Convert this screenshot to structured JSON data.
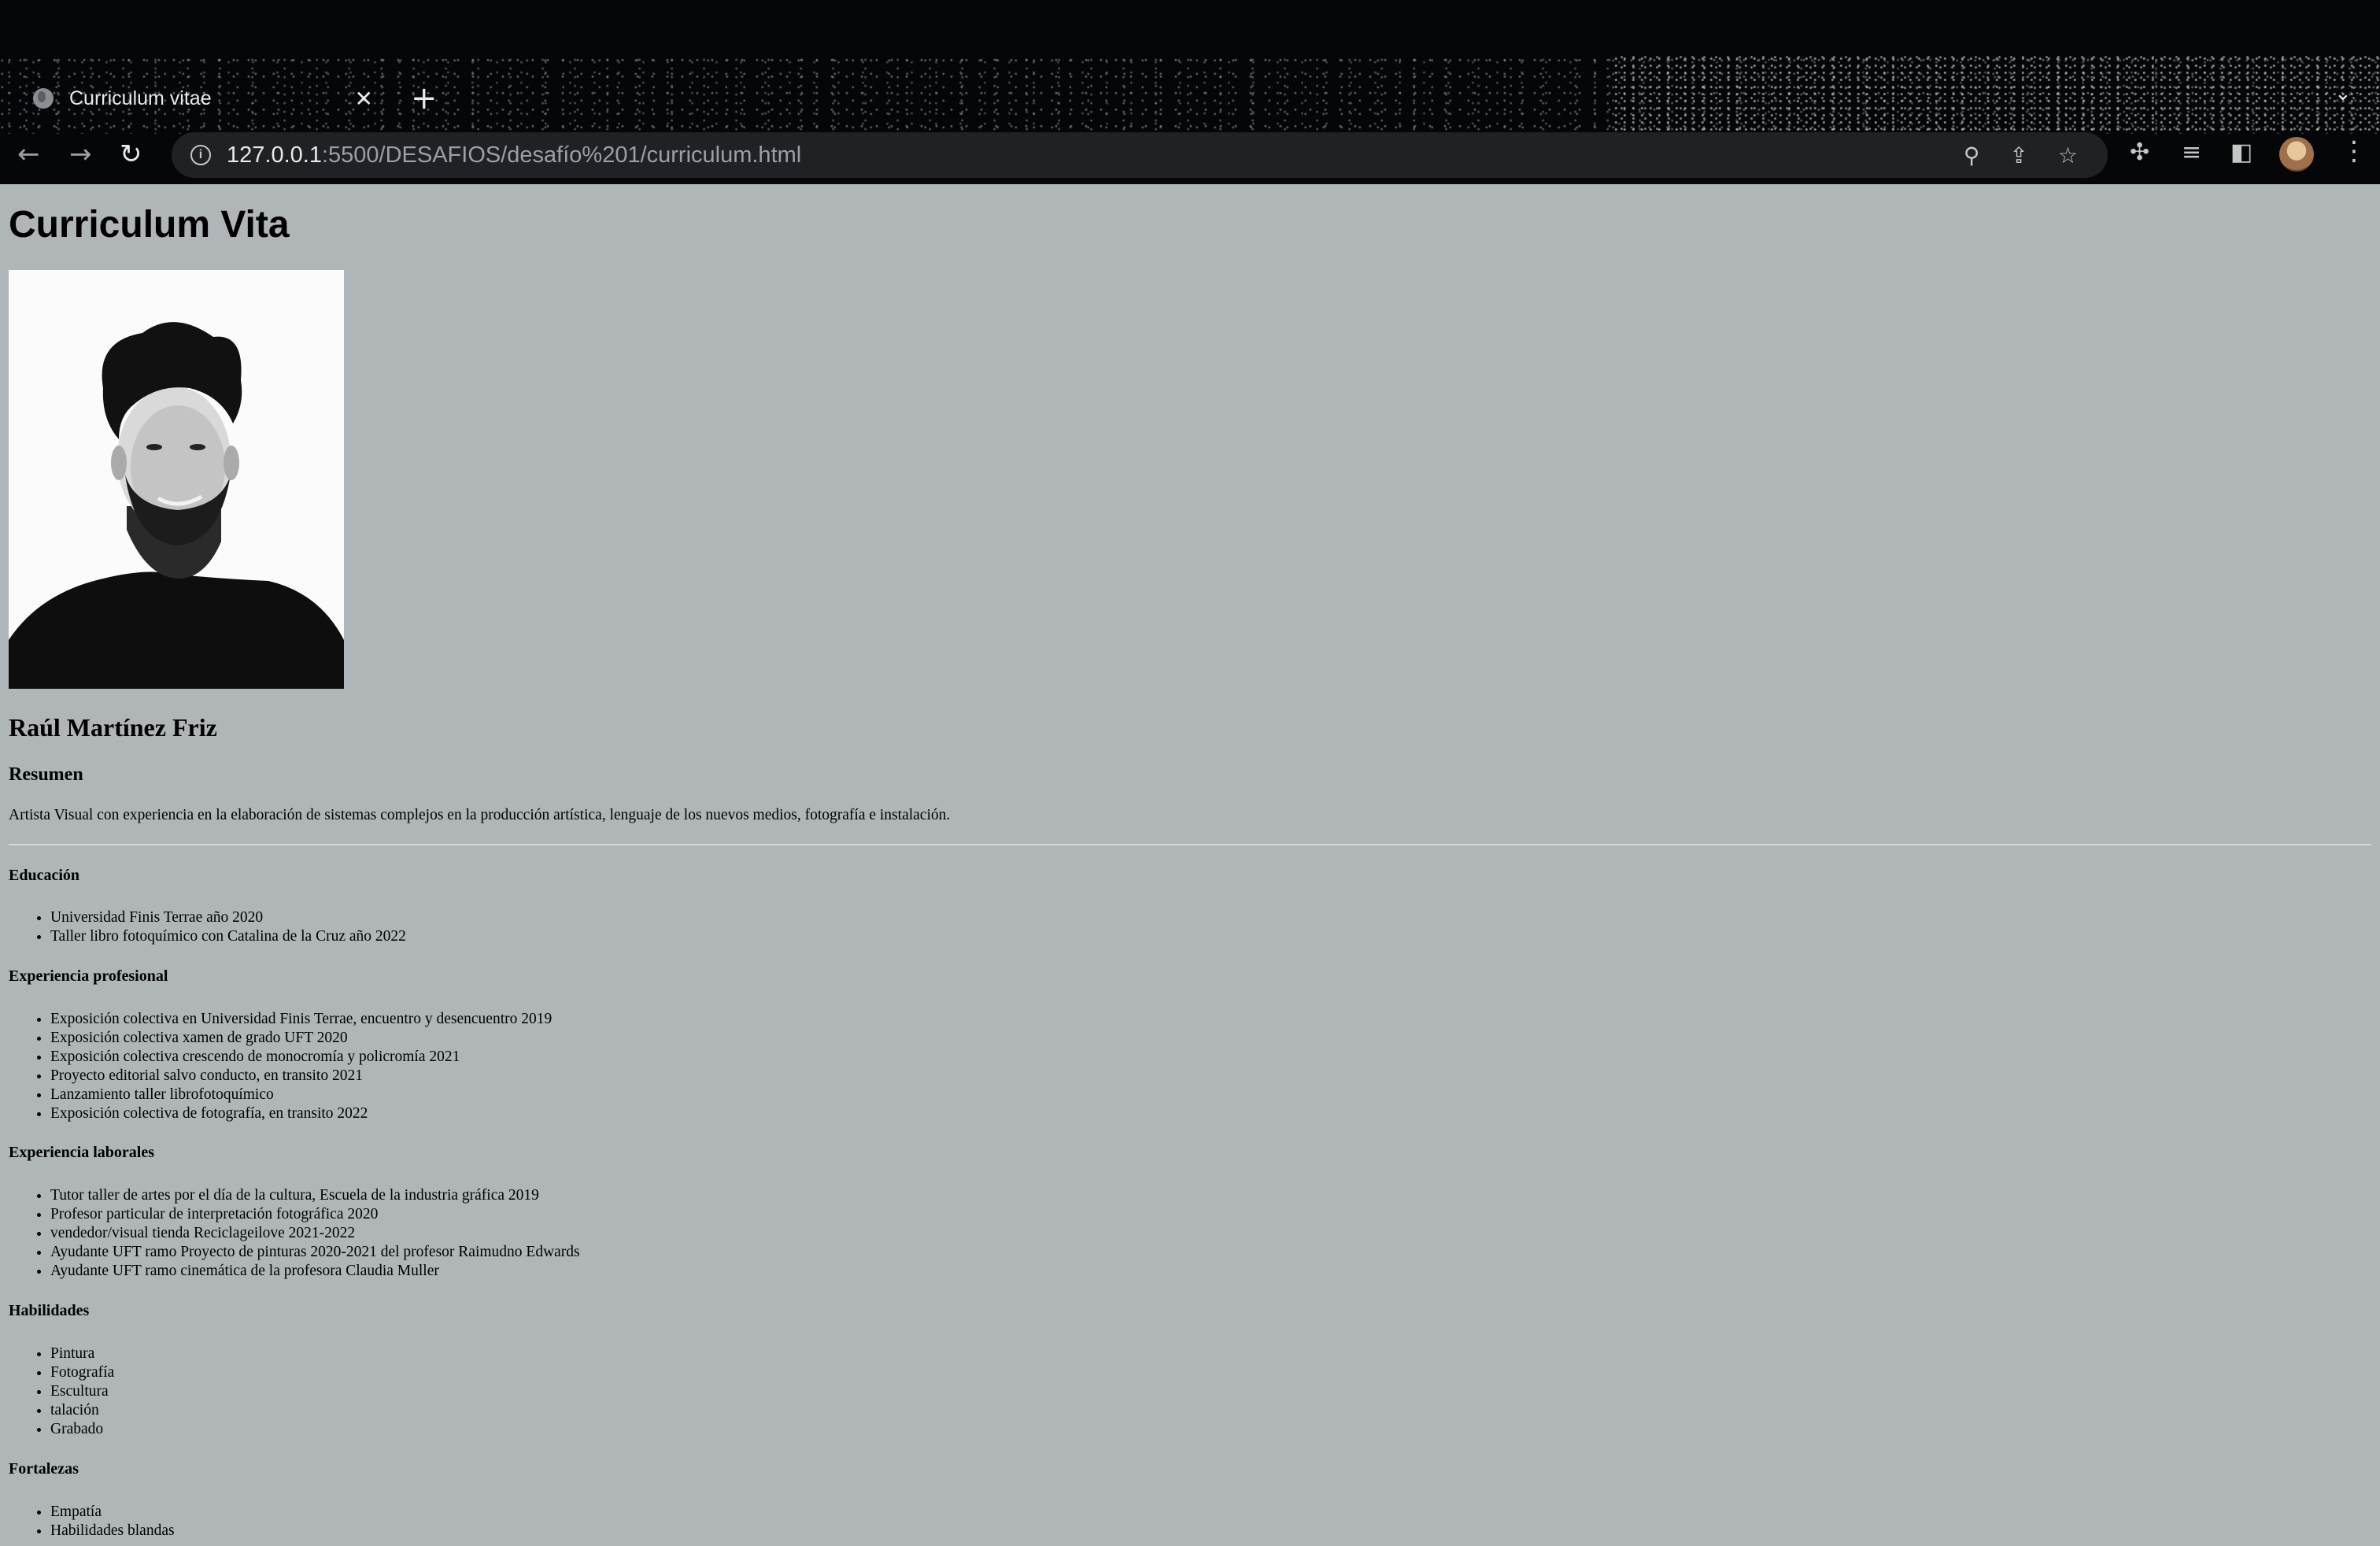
{
  "browser": {
    "tab_title": "Curriculum vitae",
    "url_host": "127.0.0.1",
    "url_rest": ":5500/DESAFIOS/desafío%201/curriculum.html"
  },
  "page": {
    "title": "Curriculum Vita",
    "name": "Raúl Martínez Friz",
    "resumen_heading": "Resumen",
    "resumen_text": "Artista Visual con experiencia en la elaboración de sistemas complejos en la producción artística, lenguaje de los nuevos medios, fotografía e instalación.",
    "educacion": {
      "heading": "Educación",
      "items": [
        "Universidad Finis Terrae año 2020",
        "Taller libro fotoquímico con Catalina de la Cruz año 2022"
      ]
    },
    "experiencia_profesional": {
      "heading": "Experiencia profesional",
      "items": [
        "Exposición colectiva en Universidad Finis Terrae, encuentro y desencuentro 2019",
        "Exposición colectiva xamen de grado UFT 2020",
        "Exposición colectiva crescendo de monocromía y policromía 2021",
        "Proyecto editorial salvo conducto, en transito 2021",
        "Lanzamiento taller librofotoquímico",
        "Exposición colectiva de fotografía, en transito 2022"
      ]
    },
    "experiencia_laborales": {
      "heading": "Experiencia laborales",
      "items": [
        "Tutor taller de artes por el día de la cultura, Escuela de la industria gráfica 2019",
        "Profesor particular de interpretación fotográfica 2020",
        "vendedor/visual tienda Reciclageilove 2021-2022",
        "Ayudante UFT ramo Proyecto de pinturas 2020-2021 del profesor Raimudno Edwards",
        "Ayudante UFT ramo cinemática de la profesora Claudia Muller"
      ]
    },
    "habilidades": {
      "heading": "Habilidades",
      "items": [
        "Pintura",
        "Fotografía",
        "Escultura",
        "talación",
        "Grabado"
      ]
    },
    "fortalezas": {
      "heading": "Fortalezas",
      "items": [
        "Empatía",
        "Habilidades blandas"
      ]
    }
  },
  "icons": {
    "tab_favicon": "globe-icon",
    "close": "✕",
    "new_tab": "+",
    "back": "←",
    "forward": "→",
    "reload": "↻",
    "zoom": "⚲",
    "share": "⇪",
    "bookmark": "☆",
    "extensions": "✣",
    "media": "≡",
    "sidepanel": "◧",
    "menu": "⋮",
    "tab_list": "⌄"
  },
  "colors": {
    "page_background": "#b0b5b8",
    "chrome_background": "#050608",
    "omnibox_background": "#202124"
  }
}
